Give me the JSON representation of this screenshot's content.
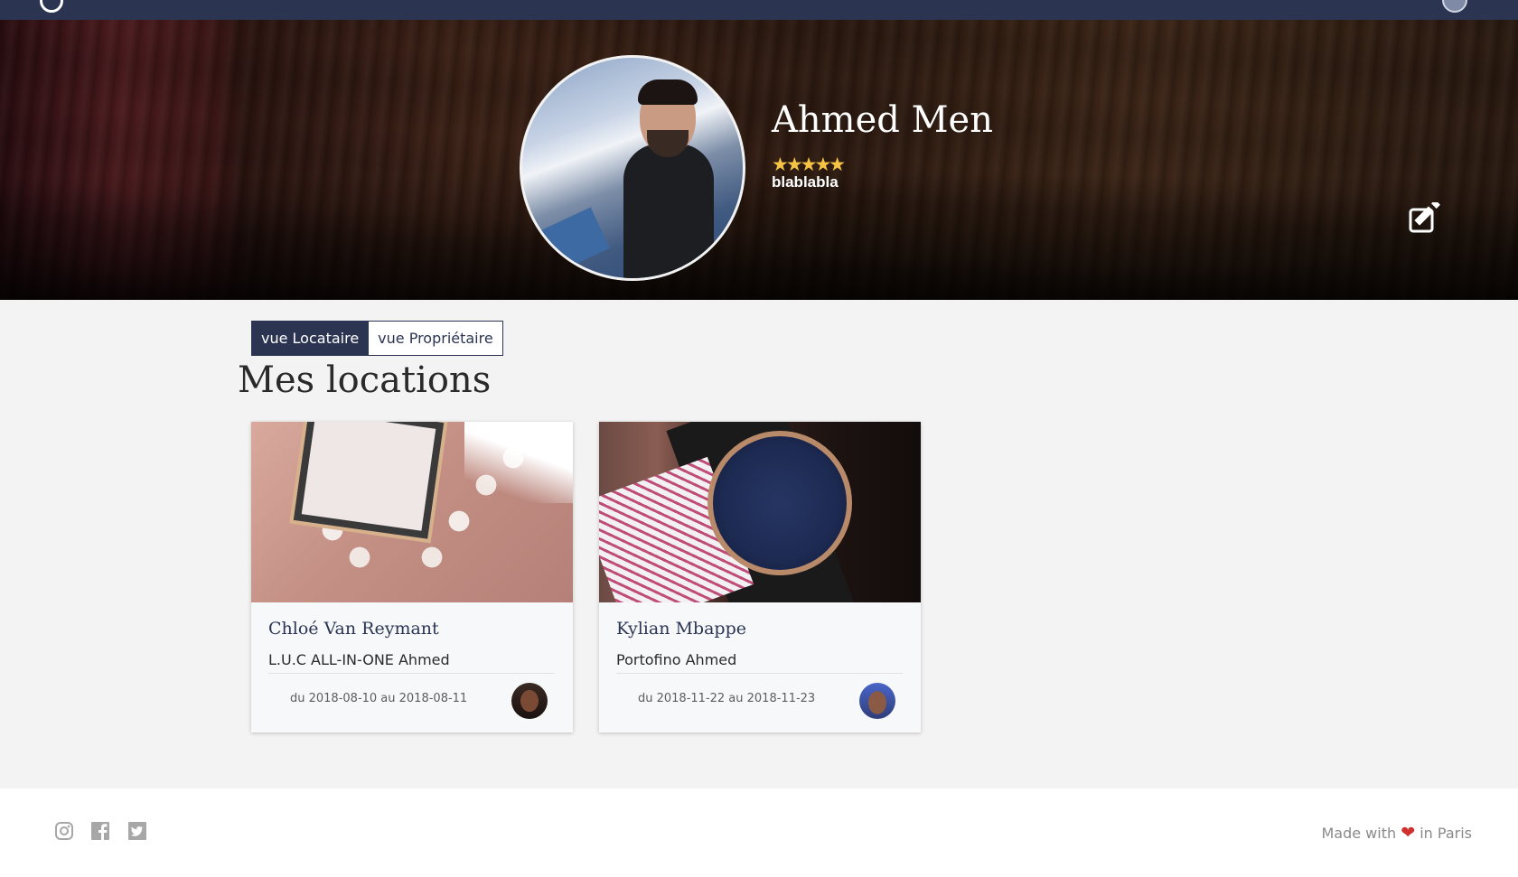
{
  "profile": {
    "name": "Ahmed Men",
    "rating": "★★★★★",
    "tagline": "blablabla"
  },
  "view_toggle": {
    "tenant": "vue Locataire",
    "owner": "vue Propriétaire"
  },
  "section": {
    "title": "Mes locations"
  },
  "rentals": [
    {
      "owner": "Chloé Van Reymant",
      "product": "L.U.C ALL-IN-ONE Ahmed",
      "dates": "du 2018-08-10 au 2018-08-11"
    },
    {
      "owner": "Kylian Mbappe",
      "product": "Portofino Ahmed",
      "dates": "du 2018-11-22 au 2018-11-23"
    }
  ],
  "footer": {
    "made_with": "Made with",
    "heart": "❤",
    "in_city": "in Paris"
  },
  "colors": {
    "navy": "#2b3552",
    "star": "#f6c445",
    "heart": "#d0312d"
  },
  "icons": {
    "edit": "edit-icon",
    "instagram": "instagram-icon",
    "facebook": "facebook-icon",
    "twitter": "twitter-icon"
  }
}
